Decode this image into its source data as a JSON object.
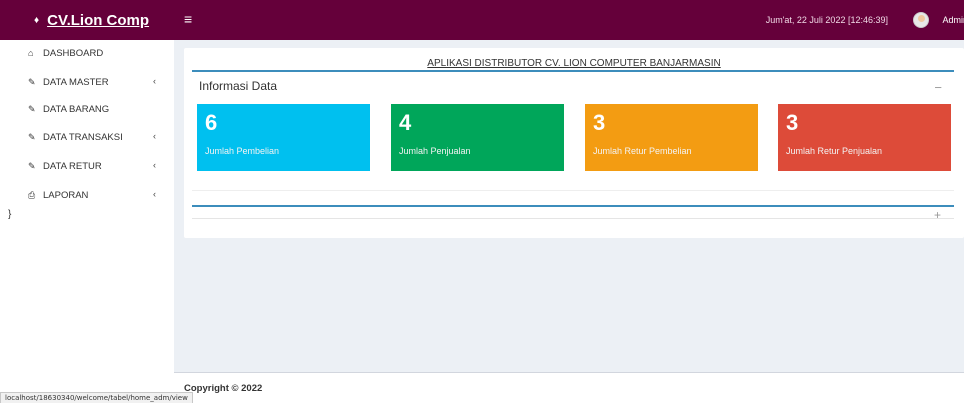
{
  "header": {
    "logo_icon": "♦",
    "logo_text": "CV.Lion Comp",
    "toggle_icon": "≡",
    "datetime": "Jum'at, 22 Juli 2022 [12:46:39]",
    "user": "Admin",
    "color": "#65003a"
  },
  "sidebar": {
    "items": [
      {
        "label": "DASHBOARD",
        "icon": "home-icon",
        "glyph": "⌂",
        "has_chevron": false
      },
      {
        "label": "DATA MASTER",
        "icon": "edit-icon",
        "glyph": "✎",
        "has_chevron": true
      },
      {
        "label": "DATA BARANG",
        "icon": "edit-icon",
        "glyph": "✎",
        "has_chevron": false
      },
      {
        "label": "DATA TRANSAKSI",
        "icon": "edit-icon",
        "glyph": "✎",
        "has_chevron": true
      },
      {
        "label": "DATA RETUR",
        "icon": "edit-icon",
        "glyph": "✎",
        "has_chevron": true
      },
      {
        "label": "LAPORAN",
        "icon": "print-icon",
        "glyph": "⎙",
        "has_chevron": true
      }
    ],
    "chevron": "‹",
    "stray": "}"
  },
  "main": {
    "app_title": "APLIKASI DISTRIBUTOR CV. LION COMPUTER BANJARMASIN",
    "section_title": "Informasi Data",
    "collapse_icon": "−",
    "expand_icon": "+",
    "tiles": [
      {
        "value": "6",
        "label": "Jumlah Pembelian",
        "color": "#00c0ef"
      },
      {
        "value": "4",
        "label": "Jumlah Penjualan",
        "color": "#00a65a"
      },
      {
        "value": "3",
        "label": "Jumlah Retur Pembelian",
        "color": "#f39c12"
      },
      {
        "value": "3",
        "label": "Jumlah Retur Penjualan",
        "color": "#dd4b39"
      }
    ]
  },
  "footer": {
    "copyright": "Copyright © 2022"
  },
  "status_bar": {
    "url": "localhost/18630340/welcome/tabel/home_adm/view"
  }
}
